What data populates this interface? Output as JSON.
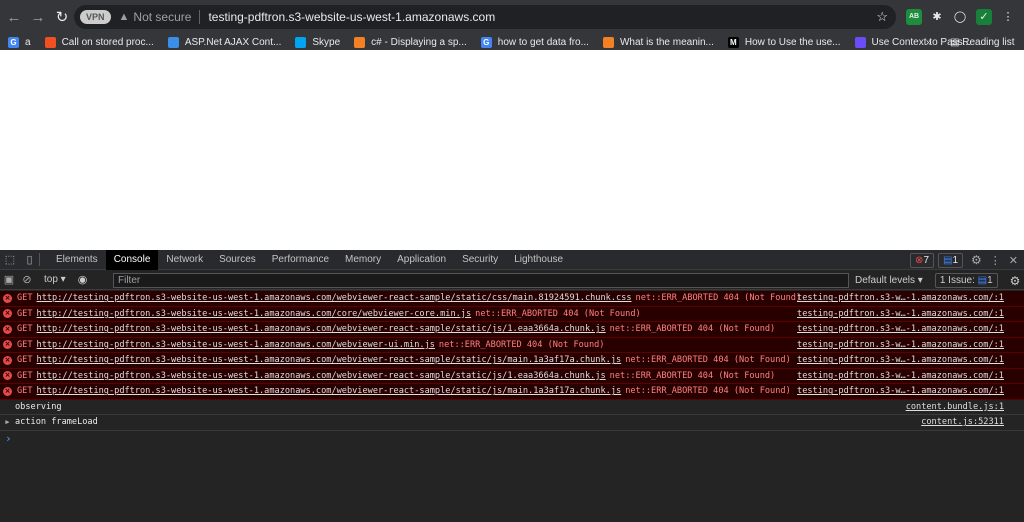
{
  "browser": {
    "url": "testing-pdftron.s3-website-us-west-1.amazonaws.com",
    "security": "Not secure",
    "vpn": "VPN",
    "bookmarks": [
      {
        "label": "a",
        "color": "#4285f4",
        "icon": "G"
      },
      {
        "label": "Call on stored proc...",
        "color": "#f25022",
        "icon": ""
      },
      {
        "label": "ASP.Net AJAX Cont...",
        "color": "#3a8ee6",
        "icon": ""
      },
      {
        "label": "Skype",
        "color": "#00a4ef",
        "icon": ""
      },
      {
        "label": "c# - Displaying a sp...",
        "color": "#f48024",
        "icon": ""
      },
      {
        "label": "how to get data fro...",
        "color": "#4285f4",
        "icon": "G"
      },
      {
        "label": "What is the meanin...",
        "color": "#f48024",
        "icon": ""
      },
      {
        "label": "How to Use the use...",
        "color": "#000000",
        "icon": "M"
      },
      {
        "label": "Use Context to Pass...",
        "color": "#6b4cf6",
        "icon": ""
      }
    ],
    "more": "»",
    "reading_list": "Reading list"
  },
  "devtools": {
    "tabs": [
      "Elements",
      "Console",
      "Network",
      "Sources",
      "Performance",
      "Memory",
      "Application",
      "Security",
      "Lighthouse"
    ],
    "active_tab": "Console",
    "error_count": "7",
    "message_count": "1",
    "context": "top",
    "filter_placeholder": "Filter",
    "levels": "Default levels",
    "issues_label": "1 Issue:",
    "issues_count": "1"
  },
  "console": {
    "errors": [
      {
        "method": "GET",
        "url": "http://testing-pdftron.s3-website-us-west-1.amazonaws.com/webviewer-react-sample/static/css/main.81924591.chunk.css",
        "msg": "net::ERR_ABORTED 404 (Not Found)",
        "src": "testing-pdftron.s3-w…-1.amazonaws.com/:1"
      },
      {
        "method": "GET",
        "url": "http://testing-pdftron.s3-website-us-west-1.amazonaws.com/core/webviewer-core.min.js",
        "msg": "net::ERR_ABORTED 404 (Not Found)",
        "src": "testing-pdftron.s3-w…-1.amazonaws.com/:1"
      },
      {
        "method": "GET",
        "url": "http://testing-pdftron.s3-website-us-west-1.amazonaws.com/webviewer-react-sample/static/js/1.eaa3664a.chunk.js",
        "msg": "net::ERR_ABORTED 404 (Not Found)",
        "src": "testing-pdftron.s3-w…-1.amazonaws.com/:1"
      },
      {
        "method": "GET",
        "url": "http://testing-pdftron.s3-website-us-west-1.amazonaws.com/webviewer-ui.min.js",
        "msg": "net::ERR_ABORTED 404 (Not Found)",
        "src": "testing-pdftron.s3-w…-1.amazonaws.com/:1"
      },
      {
        "method": "GET",
        "url": "http://testing-pdftron.s3-website-us-west-1.amazonaws.com/webviewer-react-sample/static/js/main.1a3af17a.chunk.js",
        "msg": "net::ERR_ABORTED 404 (Not Found)",
        "src": "testing-pdftron.s3-w…-1.amazonaws.com/:1"
      },
      {
        "method": "GET",
        "url": "http://testing-pdftron.s3-website-us-west-1.amazonaws.com/webviewer-react-sample/static/js/1.eaa3664a.chunk.js",
        "msg": "net::ERR_ABORTED 404 (Not Found)",
        "src": "testing-pdftron.s3-w…-1.amazonaws.com/:1"
      },
      {
        "method": "GET",
        "url": "http://testing-pdftron.s3-website-us-west-1.amazonaws.com/webviewer-react-sample/static/js/main.1a3af17a.chunk.js",
        "msg": "net::ERR_ABORTED 404 (Not Found)",
        "src": "testing-pdftron.s3-w…-1.amazonaws.com/:1"
      }
    ],
    "logs": [
      {
        "text": "observing",
        "src": "content.bundle.js:1",
        "expandable": false
      },
      {
        "text": "action frameLoad",
        "src": "content.js:52311",
        "expandable": true
      }
    ],
    "prompt": "›"
  }
}
